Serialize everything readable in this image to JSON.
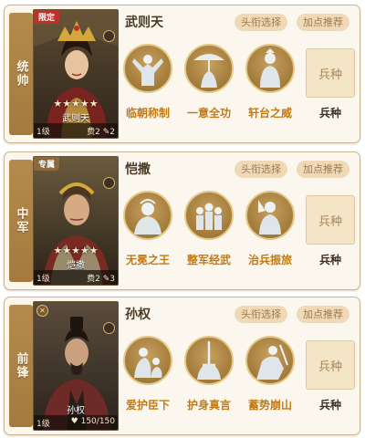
{
  "labels": {
    "title_select": "头衔选择",
    "points_recommend": "加点推荐",
    "troop_slot": "兵种",
    "troop_label": "兵种"
  },
  "cards": [
    {
      "position": "统帅",
      "tag": "限定",
      "tag_icon": "",
      "portrait_icon": "empress-portrait",
      "stars": "★★★★★",
      "portrait_name": "武则天",
      "level": "1级",
      "cost_text": "费2",
      "cost_value": "2",
      "name": "武则天",
      "skills": [
        {
          "label": "临朝称制",
          "icon": "raised-arms-icon"
        },
        {
          "label": "一意全功",
          "icon": "parasol-figure-icon"
        },
        {
          "label": "轩台之威",
          "icon": "court-lady-icon"
        }
      ]
    },
    {
      "position": "中军",
      "tag": "专属",
      "tag_icon": "",
      "portrait_icon": "caesar-portrait",
      "stars": "★★★★★",
      "portrait_name": "恺撒",
      "level": "1级",
      "cost_text": "费2",
      "cost_value": "3",
      "name": "恺撒",
      "skills": [
        {
          "label": "无冕之王",
          "icon": "crowned-bust-icon"
        },
        {
          "label": "整军经武",
          "icon": "troop-formation-icon"
        },
        {
          "label": "治兵振旅",
          "icon": "armored-knight-icon"
        }
      ]
    },
    {
      "position": "前锋",
      "tag": "",
      "tag_icon": "✕",
      "portrait_icon": "sunquan-portrait",
      "stars": "",
      "portrait_name": "孙权",
      "level": "1级",
      "cost_text": "150/150",
      "cost_value": "",
      "name": "孙权",
      "skills": [
        {
          "label": "爱护臣下",
          "icon": "kneeling-figures-icon"
        },
        {
          "label": "护身真言",
          "icon": "sword-vow-icon"
        },
        {
          "label": "蓄势崩山",
          "icon": "charging-warrior-icon"
        }
      ]
    }
  ]
}
